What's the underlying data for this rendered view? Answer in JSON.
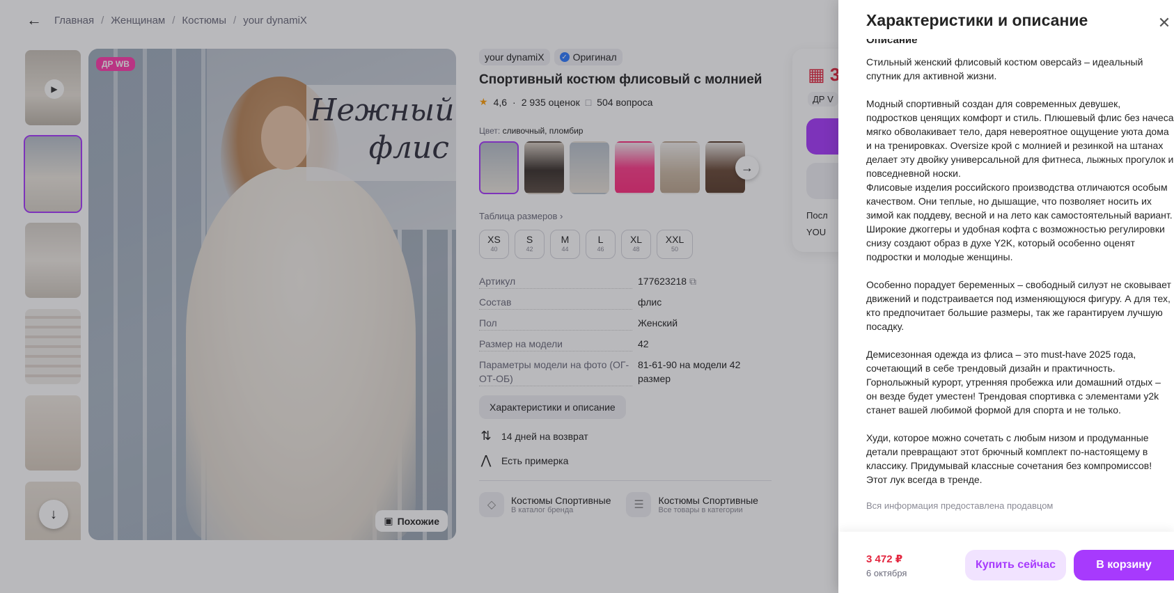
{
  "breadcrumbs": [
    "Главная",
    "Женщинам",
    "Костюмы",
    "your dynamiX"
  ],
  "gallery": {
    "badge": "ДР WB",
    "overlay_text_line1": "Нежный",
    "overlay_text_line2": "флис",
    "similar_label": "Похожие"
  },
  "product": {
    "brand": "your dynamiX",
    "original_label": "Оригинал",
    "title": "Спортивный костюм флисовый с молнией",
    "rating": "4,6",
    "reviews": "2 935 оценок",
    "questions": "504 вопроса",
    "color_label": "Цвет:",
    "color_value": "сливочный, пломбир",
    "size_table_link": "Таблица размеров",
    "sizes": [
      {
        "label": "XS",
        "ru": "40"
      },
      {
        "label": "S",
        "ru": "42"
      },
      {
        "label": "M",
        "ru": "44"
      },
      {
        "label": "L",
        "ru": "46"
      },
      {
        "label": "XL",
        "ru": "48"
      },
      {
        "label": "XXL",
        "ru": "50"
      }
    ],
    "specs": [
      {
        "key": "Артикул",
        "value": "177623218"
      },
      {
        "key": "Состав",
        "value": "флис"
      },
      {
        "key": "Пол",
        "value": "Женский"
      },
      {
        "key": "Размер на модели",
        "value": "42"
      },
      {
        "key": "Параметры модели на фото (ОГ-ОТ-ОБ)",
        "value": "81-61-90 на модели 42 размер"
      }
    ],
    "chars_button": "Характеристики и описание",
    "perks": [
      "14 дней на возврат",
      "Есть примерка"
    ],
    "catalogs": [
      {
        "title": "Костюмы Спортивные",
        "sub": "В каталог бренда"
      },
      {
        "title": "Костюмы Спортивные",
        "sub": "Все товары в категории"
      }
    ]
  },
  "buybox": {
    "price_partial": "3",
    "drwb_partial": "ДР V",
    "line1_partial": "Посл",
    "line2_partial": "YOU"
  },
  "drawer": {
    "title": "Характеристики и описание",
    "section": "Описание",
    "paragraphs": [
      "Стильный женский флисовый костюм оверсайз – идеальный спутник для активной жизни.",
      "Модный спортивный создан для современных девушек, подростков ценящих комфорт и стиль. Плюшевый флис без начеса мягко обволакивает тело, даря невероятное ощущение уюта дома и на тренировках. Oversize крой с молнией и резинкой на штанах делает эту двойку универсальной для фитнеса, лыжных прогулок и повседневной носки.\nФлисовые изделия российского производства отличаются особым качеством. Они теплые, но дышащие, что позволяет носить их зимой как поддеву, весной и на лето как самостоятельный вариант. Широкие джоггеры и удобная кофта с возможностью регулировки снизу создают образ в духе Y2K, который особенно оценят подростки и молодые женщины.",
      "Особенно порадует беременных – свободный силуэт не сковывает движений и подстраивается под изменяющуюся фигуру. А для тех, кто предпочитает большие размеры, так же гарантируем лучшую посадку.",
      "Демисезонная одежда из флиса – это must-have 2025 года, сочетающий в себе трендовый дизайн и практичность. Горнолыжный курорт, утренняя пробежка или домашний отдых – он везде будет уместен! Трендовая спортивка с элементами y2k станет вашей любимой формой для спорта и не только.",
      "Худи, которое можно сочетать с любым низом и продуманные детали превращают этот брючный комплект по-настоящему в классику. Придумывай классные сочетания без компромиссов! Этот лук всегда в тренде."
    ],
    "seller_note": "Вся информация предоставлена продавцом",
    "footer": {
      "price": "3 472 ₽",
      "date": "6 октября",
      "buy_now": "Купить сейчас",
      "to_cart": "В корзину"
    }
  },
  "colors": {
    "accent": "#a73afd",
    "price": "#e3263f",
    "badge": "#ff3cac"
  }
}
